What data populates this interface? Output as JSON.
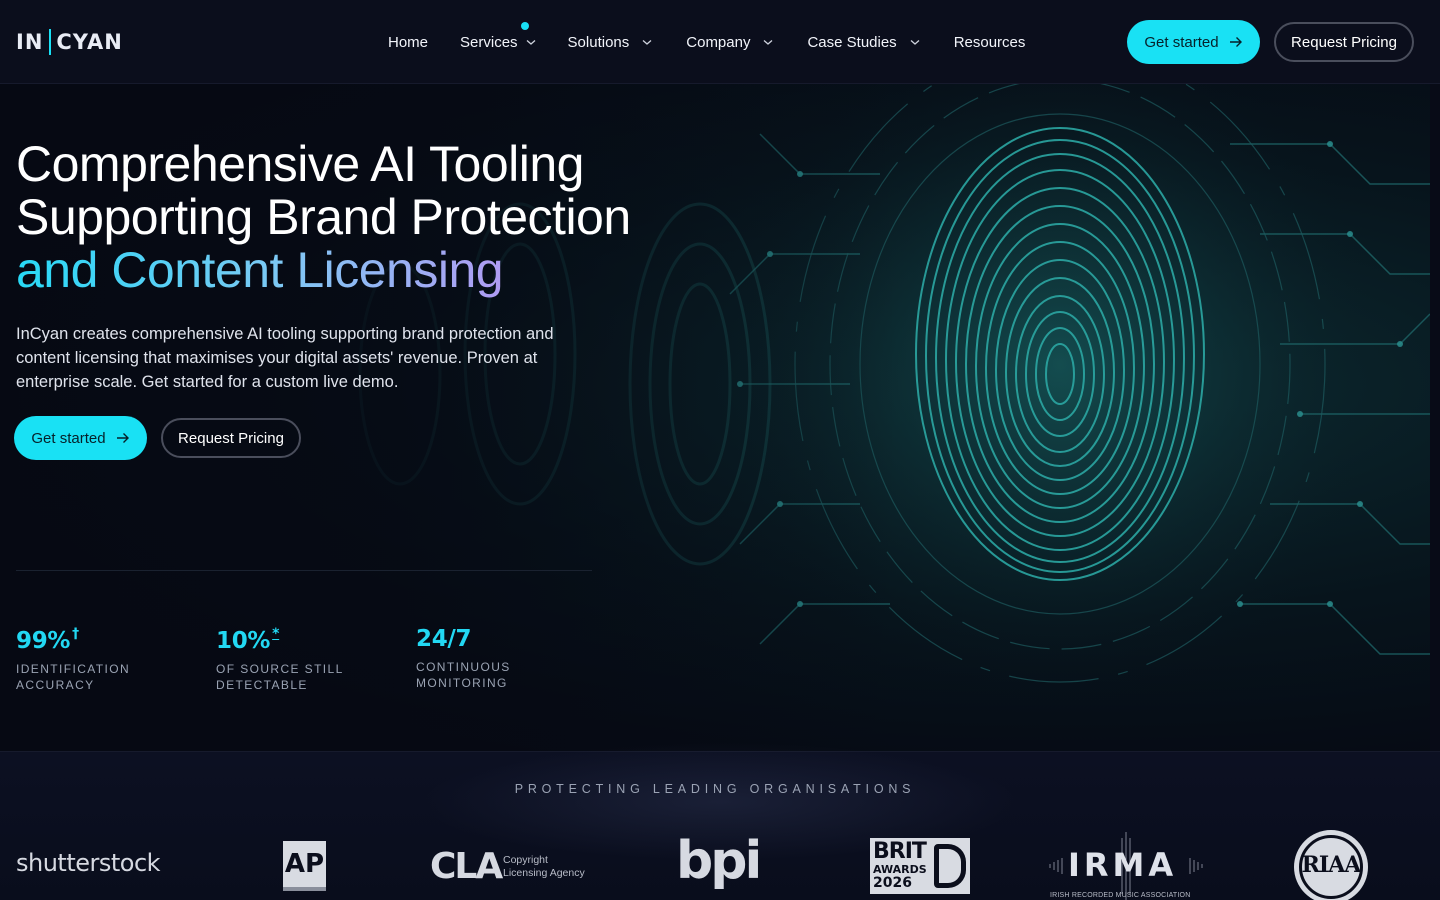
{
  "header": {
    "logo_left": "IN",
    "logo_right": "CYAN",
    "nav": [
      {
        "label": "Home",
        "has_dropdown": false
      },
      {
        "label": "Services",
        "has_dropdown": true,
        "has_indicator": true
      },
      {
        "label": "Solutions",
        "has_dropdown": true
      },
      {
        "label": "Company",
        "has_dropdown": true
      },
      {
        "label": "Case Studies",
        "has_dropdown": true
      },
      {
        "label": "Resources",
        "has_dropdown": false
      }
    ],
    "get_started_label": "Get started",
    "request_pricing_label": "Request Pricing"
  },
  "hero": {
    "title_line1": "Comprehensive AI Tooling",
    "title_line2": "Supporting Brand Protection",
    "title_line3": "and Content Licensing",
    "description": "InCyan creates comprehensive AI tooling supporting brand protection and content licensing that maximises your digital assets' revenue. Proven at enterprise scale. Get started for a custom live demo.",
    "get_started_label": "Get started",
    "request_pricing_label": "Request Pricing",
    "stats": [
      {
        "value": "99%",
        "mark": "†",
        "label": "IDENTIFICATION ACCURACY"
      },
      {
        "value": "10%",
        "mark": "*",
        "label": "OF SOURCE STILL DETECTABLE"
      },
      {
        "value": "24/7",
        "mark": "",
        "label": "CONTINUOUS MONITORING"
      }
    ]
  },
  "partners": {
    "title": "PROTECTING LEADING ORGANISATIONS",
    "shutterstock": "shutterstock",
    "ap": "AP",
    "cla_mark": "CLA",
    "cla_sub1": "Copyright",
    "cla_sub2": "Licensing Agency",
    "bpi": "bpi",
    "brit1": "BRIT",
    "brit2": "AWARDS",
    "brit3": "2026",
    "irma": "IRMA",
    "irma_sub": "IRISH RECORDED MUSIC ASSOCIATION",
    "riaa": "RIAA"
  },
  "colors": {
    "accent": "#19e1f4",
    "background": "#080b17",
    "gradient_end": "#b09cf3"
  },
  "icons": [
    "chevron-down-icon",
    "arrow-right-icon",
    "fingerprint-graphic"
  ]
}
